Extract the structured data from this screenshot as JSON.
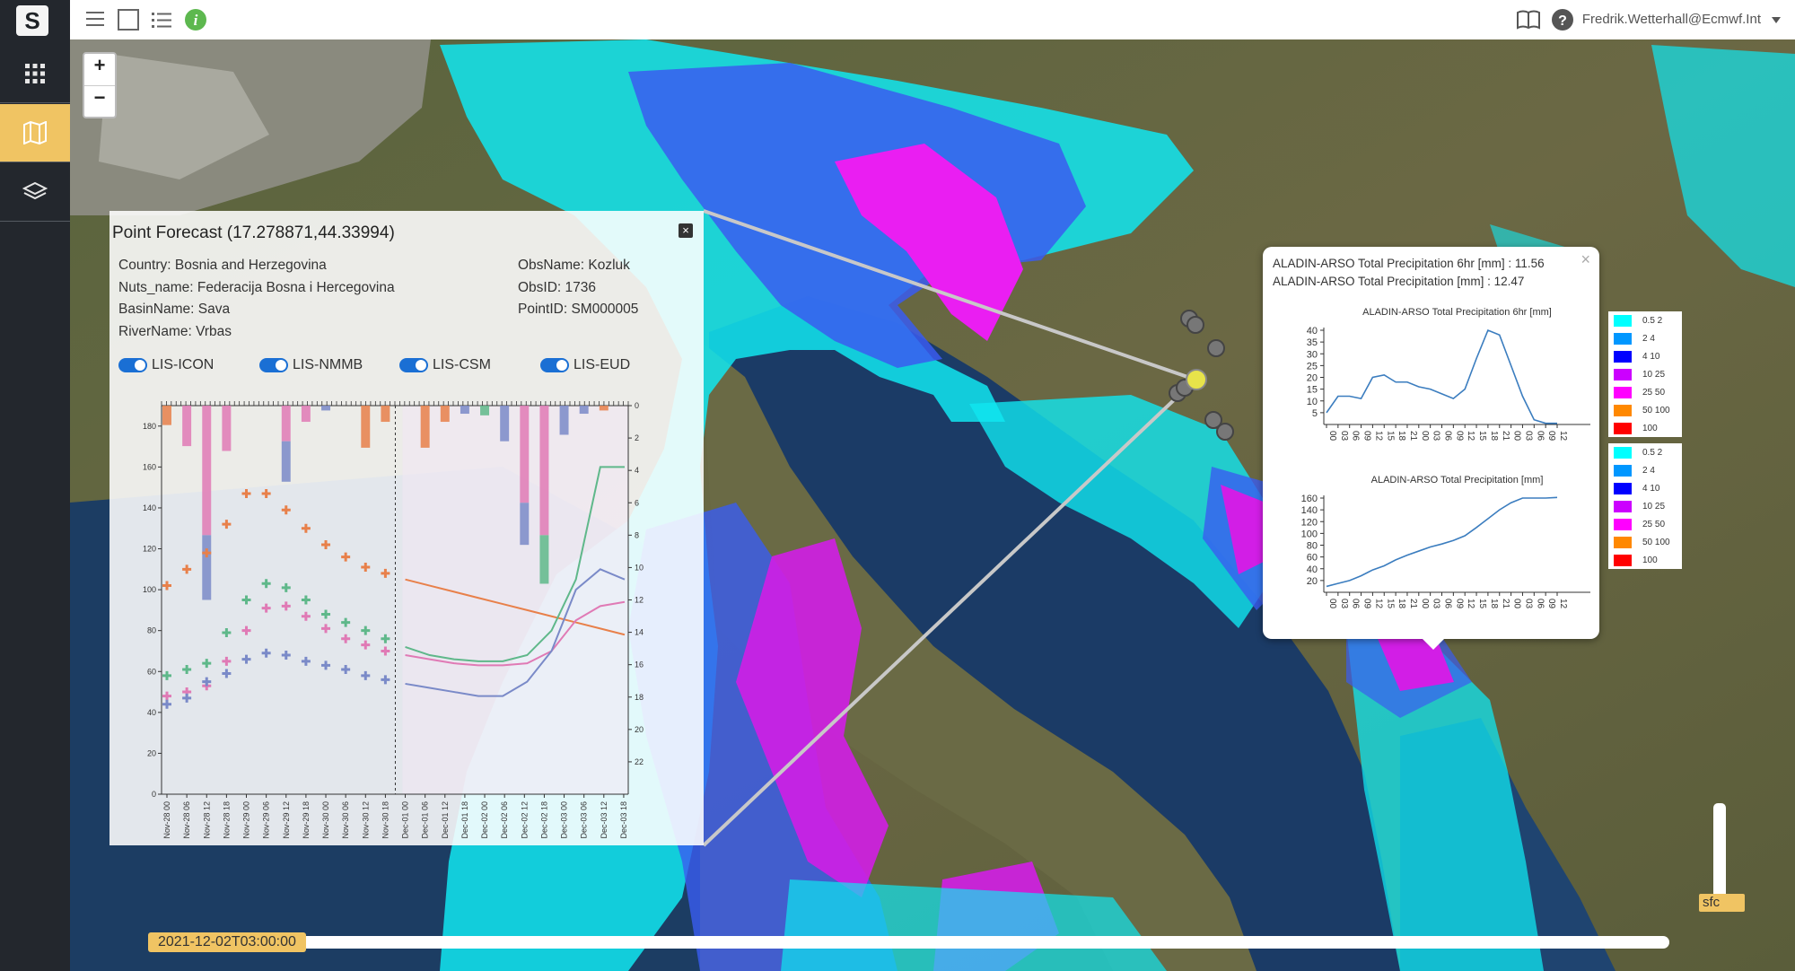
{
  "app": {
    "logo": "S",
    "user": "Fredrik.Wetterhall@Ecmwf.Int"
  },
  "colors": {
    "accent": "#f0c463",
    "sidebar": "#23272d",
    "switch": "#1a6fd4"
  },
  "sidebar": {
    "items": [
      {
        "icon": "apps-grid-icon"
      },
      {
        "icon": "map-icon",
        "active": true
      },
      {
        "icon": "layers-icon"
      }
    ]
  },
  "toolbar": {
    "icons": [
      "menu-icon",
      "square-icon",
      "list-icon",
      "info-icon",
      "book-icon",
      "help-icon",
      "caret-down-icon"
    ]
  },
  "zoom": {
    "in": "+",
    "out": "−"
  },
  "point_forecast": {
    "title": "Point Forecast (17.278871,44.33994)",
    "close": "×",
    "info_left": [
      "Country: Bosnia and Herzegovina",
      "Nuts_name: Federacija Bosna i Hercegovina",
      "BasinName: Sava",
      "RiverName: Vrbas"
    ],
    "info_right": [
      "ObsName: Kozluk",
      "ObsID: 1736",
      "PointID: SM000005"
    ],
    "toggles": [
      "LIS-ICON",
      "LIS-NMMB",
      "LIS-CSM",
      "LIS-EUD"
    ]
  },
  "popup": {
    "close": "×",
    "line1": "ALADIN-ARSO Total Precipitation 6hr [mm] : 11.56",
    "line2": "ALADIN-ARSO Total Precipitation [mm] : 12.47"
  },
  "legend": {
    "classes": [
      {
        "label": "0.5 2",
        "color": "#00ffff"
      },
      {
        "label": "2 4",
        "color": "#0097ff"
      },
      {
        "label": "4 10",
        "color": "#0000ff"
      },
      {
        "label": "10 25",
        "color": "#cc00ff"
      },
      {
        "label": "25 50",
        "color": "#ff00ff"
      },
      {
        "label": "50 100",
        "color": "#ff8800"
      },
      {
        "label": "100",
        "color": "#ff0000"
      }
    ]
  },
  "time": {
    "value": "2021-12-02T03:00:00"
  },
  "level": {
    "value": "sfc"
  },
  "chart_data": [
    {
      "type": "line",
      "title": "ALADIN-ARSO Total Precipitation 6hr [mm]",
      "x": [
        "00",
        "03",
        "06",
        "09",
        "12",
        "15",
        "18",
        "21",
        "00",
        "03",
        "06",
        "09",
        "12",
        "15",
        "18",
        "21",
        "00",
        "03",
        "06",
        "09",
        "12"
      ],
      "y": [
        5,
        12,
        12,
        11,
        20,
        21,
        18,
        18,
        16,
        15,
        13,
        11,
        15,
        28,
        40,
        38,
        25,
        12,
        2,
        0.5,
        0.5
      ],
      "ylim": [
        0,
        40
      ],
      "yticks": [
        5,
        10,
        15,
        20,
        25,
        30,
        35,
        40
      ]
    },
    {
      "type": "line",
      "title": "ALADIN-ARSO Total Precipitation [mm]",
      "x": [
        "00",
        "03",
        "06",
        "09",
        "12",
        "15",
        "18",
        "21",
        "00",
        "03",
        "06",
        "09",
        "12",
        "15",
        "18",
        "21",
        "00",
        "03",
        "06",
        "09",
        "12"
      ],
      "y": [
        10,
        15,
        20,
        28,
        38,
        45,
        55,
        63,
        70,
        77,
        82,
        88,
        96,
        110,
        125,
        140,
        152,
        160,
        160,
        160,
        161
      ],
      "ylim": [
        0,
        160
      ],
      "yticks": [
        20,
        40,
        60,
        80,
        100,
        120,
        140,
        160
      ]
    },
    {
      "type": "line",
      "categories": [
        "Nov-28 00",
        "Nov-28 06",
        "Nov-28 12",
        "Nov-28 18",
        "Nov-29 00",
        "Nov-29 06",
        "Nov-29 12",
        "Nov-29 18",
        "Nov-30 00",
        "Nov-30 06",
        "Nov-30 12",
        "Nov-30 18",
        "Dec-01 00",
        "Dec-01 06",
        "Dec-01 12",
        "Dec-01 18",
        "Dec-02 00",
        "Dec-02 06",
        "Dec-02 12",
        "Dec-02 18",
        "Dec-03 00",
        "Dec-03 06",
        "Dec-03 12",
        "Dec-03 18"
      ],
      "ylim_left": [
        0,
        190
      ],
      "yticks_left": [
        0,
        20,
        40,
        60,
        80,
        100,
        120,
        140,
        160,
        180
      ],
      "ylim_right": [
        0,
        24
      ],
      "yticks_right": [
        0,
        2,
        4,
        6,
        8,
        10,
        12,
        14,
        16,
        18,
        20,
        22
      ],
      "observed": [
        {
          "color": "#e8804a",
          "values": [
            102,
            110,
            118,
            132,
            147,
            147,
            139,
            130,
            122,
            116,
            111,
            108
          ]
        },
        {
          "color": "#5fb88a",
          "values": [
            58,
            61,
            64,
            79,
            95,
            103,
            101,
            95,
            88,
            84,
            80,
            76
          ]
        },
        {
          "color": "#e07ab5",
          "values": [
            48,
            50,
            53,
            65,
            80,
            91,
            92,
            87,
            81,
            76,
            73,
            70
          ]
        },
        {
          "color": "#7a8ac8",
          "values": [
            44,
            47,
            55,
            59,
            66,
            69,
            68,
            65,
            63,
            61,
            58,
            56
          ]
        }
      ],
      "forecast": [
        {
          "color": "#e8804a",
          "values": [
            105,
            102,
            99,
            96,
            93,
            90,
            87,
            84,
            81,
            78
          ]
        },
        {
          "color": "#5fb88a",
          "values": [
            72,
            68,
            66,
            65,
            65,
            68,
            80,
            105,
            160,
            160
          ]
        },
        {
          "color": "#e07ab5",
          "values": [
            68,
            66,
            64,
            63,
            63,
            64,
            70,
            85,
            92,
            94
          ]
        },
        {
          "color": "#7a8ac8",
          "values": [
            54,
            52,
            50,
            48,
            48,
            55,
            70,
            100,
            110,
            105
          ]
        }
      ],
      "precip_bars": [
        {
          "x": 0,
          "values": [
            {
              "v": 1.2,
              "c": "#e8804a"
            }
          ]
        },
        {
          "x": 1,
          "values": [
            {
              "v": 2.5,
              "c": "#e07ab5"
            }
          ]
        },
        {
          "x": 2,
          "values": [
            {
              "v": 8,
              "c": "#e07ab5"
            },
            {
              "v": 4,
              "c": "#7a8ac8"
            }
          ]
        },
        {
          "x": 3,
          "values": [
            {
              "v": 2.8,
              "c": "#e07ab5"
            }
          ]
        },
        {
          "x": 6,
          "values": [
            {
              "v": 2.2,
              "c": "#e07ab5"
            },
            {
              "v": 2.5,
              "c": "#7a8ac8"
            }
          ]
        },
        {
          "x": 7,
          "values": [
            {
              "v": 1,
              "c": "#e07ab5"
            }
          ]
        },
        {
          "x": 8,
          "values": [
            {
              "v": 0.3,
              "c": "#7a8ac8"
            }
          ]
        },
        {
          "x": 10,
          "values": [
            {
              "v": 2.6,
              "c": "#e8804a"
            }
          ]
        },
        {
          "x": 11,
          "values": [
            {
              "v": 1,
              "c": "#e8804a"
            }
          ]
        },
        {
          "x": 13,
          "values": [
            {
              "v": 2.6,
              "c": "#e8804a"
            }
          ]
        },
        {
          "x": 14,
          "values": [
            {
              "v": 1,
              "c": "#e8804a"
            }
          ]
        },
        {
          "x": 15,
          "values": [
            {
              "v": 0.5,
              "c": "#7a8ac8"
            }
          ]
        },
        {
          "x": 16,
          "values": [
            {
              "v": 0.6,
              "c": "#5fb88a"
            }
          ]
        },
        {
          "x": 17,
          "values": [
            {
              "v": 2.2,
              "c": "#7a8ac8"
            }
          ]
        },
        {
          "x": 18,
          "values": [
            {
              "v": 6,
              "c": "#e07ab5"
            },
            {
              "v": 2.6,
              "c": "#7a8ac8"
            }
          ]
        },
        {
          "x": 19,
          "values": [
            {
              "v": 8,
              "c": "#e07ab5"
            },
            {
              "v": 3,
              "c": "#5fb88a"
            }
          ]
        },
        {
          "x": 20,
          "values": [
            {
              "v": 1.8,
              "c": "#7a8ac8"
            }
          ]
        },
        {
          "x": 21,
          "values": [
            {
              "v": 0.5,
              "c": "#7a8ac8"
            }
          ]
        },
        {
          "x": 22,
          "values": [
            {
              "v": 0.3,
              "c": "#e8804a"
            }
          ]
        }
      ]
    }
  ]
}
